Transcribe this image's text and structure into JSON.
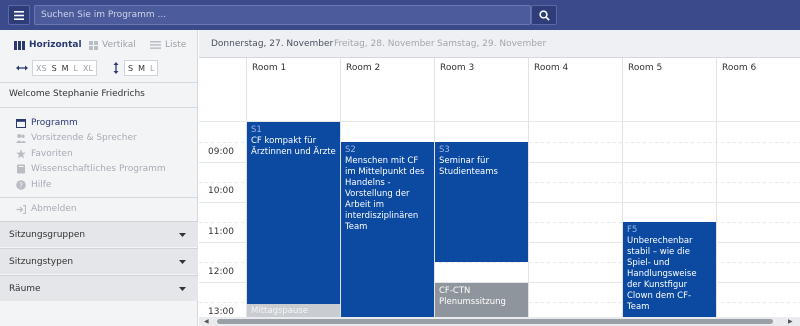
{
  "search": {
    "placeholder": "Suchen Sie im Programm ..."
  },
  "icons": {
    "menu": "hamburger-icon",
    "search": "search-icon"
  },
  "view_tabs": [
    {
      "label": "Horizontal",
      "active": true
    },
    {
      "label": "Vertikal",
      "active": false
    },
    {
      "label": "Liste",
      "active": false
    }
  ],
  "width_sizes": [
    "XS",
    "S",
    "M",
    "L",
    "XL"
  ],
  "width_selected": [
    "S",
    "M"
  ],
  "height_sizes": [
    "S",
    "M",
    "L"
  ],
  "height_selected": [
    "S",
    "M"
  ],
  "welcome": "Welcome Stephanie Friedrichs",
  "nav": [
    {
      "label": "Programm",
      "icon": "calendar-icon",
      "active": true
    },
    {
      "label": "Vorsitzende & Sprecher",
      "icon": "people-icon",
      "active": false
    },
    {
      "label": "Favoriten",
      "icon": "star-icon",
      "active": false
    },
    {
      "label": "Wissenschaftliches Programm",
      "icon": "book-icon",
      "active": false
    },
    {
      "label": "Hilfe",
      "icon": "help-icon",
      "active": false
    }
  ],
  "logout": "Abmelden",
  "accordions": [
    "Sitzungsgruppen",
    "Sitzungstypen",
    "Räume"
  ],
  "days": [
    {
      "label": "Donnerstag, 27. November",
      "active": true
    },
    {
      "label": "Freitag, 28. November",
      "active": false
    },
    {
      "label": "Samstag, 29. November",
      "active": false
    }
  ],
  "rooms": [
    "Room 1",
    "Room 2",
    "Room 3",
    "Room 4",
    "Room 5",
    "Room 6"
  ],
  "times": [
    "09:00",
    "10:00",
    "11:00",
    "12:00",
    "13:00"
  ],
  "sessions": [
    {
      "code": "S1",
      "title": "CF kompakt für Ärztinnen und Ärzte"
    },
    {
      "code": "S2",
      "title": "Menschen mit CF im Mittelpunkt des Handelns - Vorstellung der Arbeit im interdisziplinären Team"
    },
    {
      "code": "S3",
      "title": "Seminar für Studienteams"
    },
    {
      "code": "",
      "title": "CF-CTN Plenumssitzung"
    },
    {
      "code": "F5",
      "title": "Unberechenbar stabil – wie die Spiel- und Handlungsweise der Kunstfigur Clown dem CF-Team"
    }
  ],
  "pause": "Mittagspause",
  "colors": {
    "topbar": "#3a4a8a",
    "session": "#0b4aa0",
    "session_grey": "#8f959c",
    "sidebar": "#f3f4f6"
  }
}
